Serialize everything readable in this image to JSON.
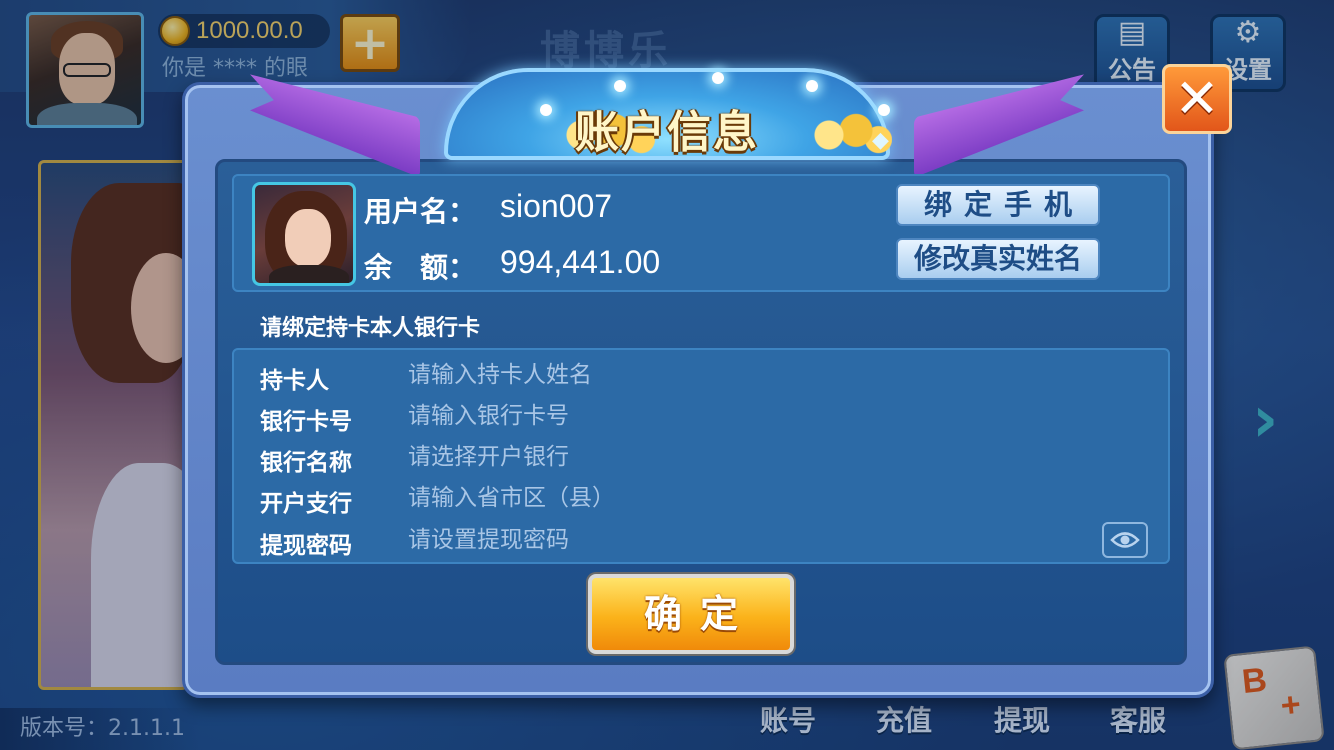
{
  "header": {
    "coin_amount": "1000.00.0",
    "marquee": "你是 **** 的眼",
    "add_coin": "+",
    "logo_text": "博博乐",
    "notice_label": "公告",
    "settings_label": "设置"
  },
  "dialog": {
    "title": "账户信息",
    "close": "✕",
    "user": {
      "username_label": "用户名：",
      "username": "sion007",
      "balance_label": "余　额：",
      "balance": "994,441.00"
    },
    "bind_phone_label": "绑定手机",
    "edit_name_label": "修改真实姓名",
    "bank_hint": "请绑定持卡本人银行卡",
    "fields": [
      {
        "label": "持卡人",
        "placeholder": "请输入持卡人姓名"
      },
      {
        "label": "银行卡号",
        "placeholder": "请输入银行卡号"
      },
      {
        "label": "银行名称",
        "placeholder": "请选择开户银行"
      },
      {
        "label": "开户支行",
        "placeholder": "请输入省市区（县）"
      },
      {
        "label": "提现密码",
        "placeholder": "请设置提现密码"
      }
    ],
    "confirm_label": "确定"
  },
  "footer": {
    "version": "版本号：2.1.1.1",
    "account": "账号",
    "recharge": "充值",
    "withdraw": "提现",
    "service": "客服",
    "brand_letter": "B"
  },
  "colors": {
    "accent_gold": "#fbb21a",
    "close_orange": "#e2561a",
    "panel_blue": "#2c6aa6",
    "ribbon_purple": "#9a50d4"
  },
  "icons": [
    "coin-icon",
    "plus-icon",
    "chat-icon",
    "gear-icon",
    "close-icon",
    "eye-icon",
    "chevron-right-icon"
  ]
}
